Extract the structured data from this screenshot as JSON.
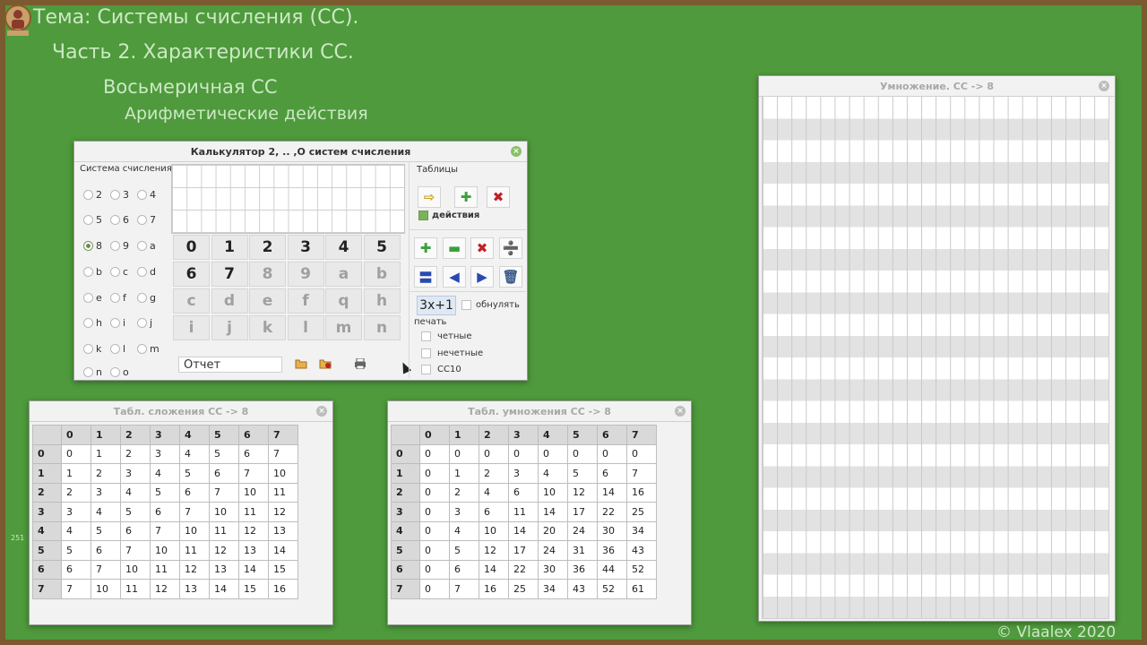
{
  "titles": {
    "line1": "Тема: Системы счисления (СС).",
    "line2": "Часть 2. Характеристики СС.",
    "line3": "Восьмеричная СС",
    "line4": "Арифметические действия"
  },
  "colors": {
    "board": "#4e9a3c",
    "frame": "#7a5a2e",
    "title_text": "#cde8c4"
  },
  "calculator": {
    "title": "Калькулятор 2, .. ,О систем счисления",
    "system_label": "Система счисления",
    "radix_options": [
      "2",
      "3",
      "4",
      "5",
      "6",
      "7",
      "8",
      "9",
      "a",
      "b",
      "c",
      "d",
      "e",
      "f",
      "g",
      "h",
      "i",
      "j",
      "k",
      "l",
      "m",
      "n",
      "o"
    ],
    "selected_radix": "8",
    "keys": [
      "0",
      "1",
      "2",
      "3",
      "4",
      "5",
      "6",
      "7",
      "8",
      "9",
      "a",
      "b",
      "c",
      "d",
      "e",
      "f",
      "q",
      "h",
      "i",
      "j",
      "k",
      "l",
      "m",
      "n"
    ],
    "active_key_count": 8,
    "report_value": "Отчет",
    "tables_label": "Таблицы",
    "actions_label": "действия",
    "actions_checked": true,
    "func_label": "3x+1",
    "reset_label": "обнулять",
    "print_label": "печать",
    "print_options": [
      "четные",
      "нечетные",
      "СС10"
    ],
    "icons": [
      "arrow-right-icon",
      "plus-icon",
      "multiply-icon",
      "add-icon",
      "minus-icon",
      "times-icon",
      "divide-icon",
      "equals-icon",
      "back-icon",
      "forward-icon",
      "trash-icon",
      "open-folder-icon",
      "delete-folder-icon",
      "printer-icon"
    ]
  },
  "addition_table": {
    "title": "Табл. сложения СС -> 8",
    "headers": [
      "0",
      "1",
      "2",
      "3",
      "4",
      "5",
      "6",
      "7"
    ],
    "rows": [
      [
        "0",
        "0",
        "1",
        "2",
        "3",
        "4",
        "5",
        "6",
        "7"
      ],
      [
        "1",
        "1",
        "2",
        "3",
        "4",
        "5",
        "6",
        "7",
        "10"
      ],
      [
        "2",
        "2",
        "3",
        "4",
        "5",
        "6",
        "7",
        "10",
        "11"
      ],
      [
        "3",
        "3",
        "4",
        "5",
        "6",
        "7",
        "10",
        "11",
        "12"
      ],
      [
        "4",
        "4",
        "5",
        "6",
        "7",
        "10",
        "11",
        "12",
        "13"
      ],
      [
        "5",
        "5",
        "6",
        "7",
        "10",
        "11",
        "12",
        "13",
        "14"
      ],
      [
        "6",
        "6",
        "7",
        "10",
        "11",
        "12",
        "13",
        "14",
        "15"
      ],
      [
        "7",
        "7",
        "10",
        "11",
        "12",
        "13",
        "14",
        "15",
        "16"
      ]
    ]
  },
  "multiplication_table": {
    "title": "Табл. умножения СС -> 8",
    "headers": [
      "0",
      "1",
      "2",
      "3",
      "4",
      "5",
      "6",
      "7"
    ],
    "rows": [
      [
        "0",
        "0",
        "0",
        "0",
        "0",
        "0",
        "0",
        "0",
        "0"
      ],
      [
        "1",
        "0",
        "1",
        "2",
        "3",
        "4",
        "5",
        "6",
        "7"
      ],
      [
        "2",
        "0",
        "2",
        "4",
        "6",
        "10",
        "12",
        "14",
        "16"
      ],
      [
        "3",
        "0",
        "3",
        "6",
        "11",
        "14",
        "17",
        "22",
        "25"
      ],
      [
        "4",
        "0",
        "4",
        "10",
        "14",
        "20",
        "24",
        "30",
        "34"
      ],
      [
        "5",
        "0",
        "5",
        "12",
        "17",
        "24",
        "31",
        "36",
        "43"
      ],
      [
        "6",
        "0",
        "6",
        "14",
        "22",
        "30",
        "36",
        "44",
        "52"
      ],
      [
        "7",
        "0",
        "7",
        "16",
        "25",
        "34",
        "43",
        "52",
        "61"
      ]
    ]
  },
  "grid_window": {
    "title": "Умножение. СС -> 8"
  },
  "footer": {
    "copyright": "©   Vlaalex  2020",
    "page_number": "251"
  }
}
